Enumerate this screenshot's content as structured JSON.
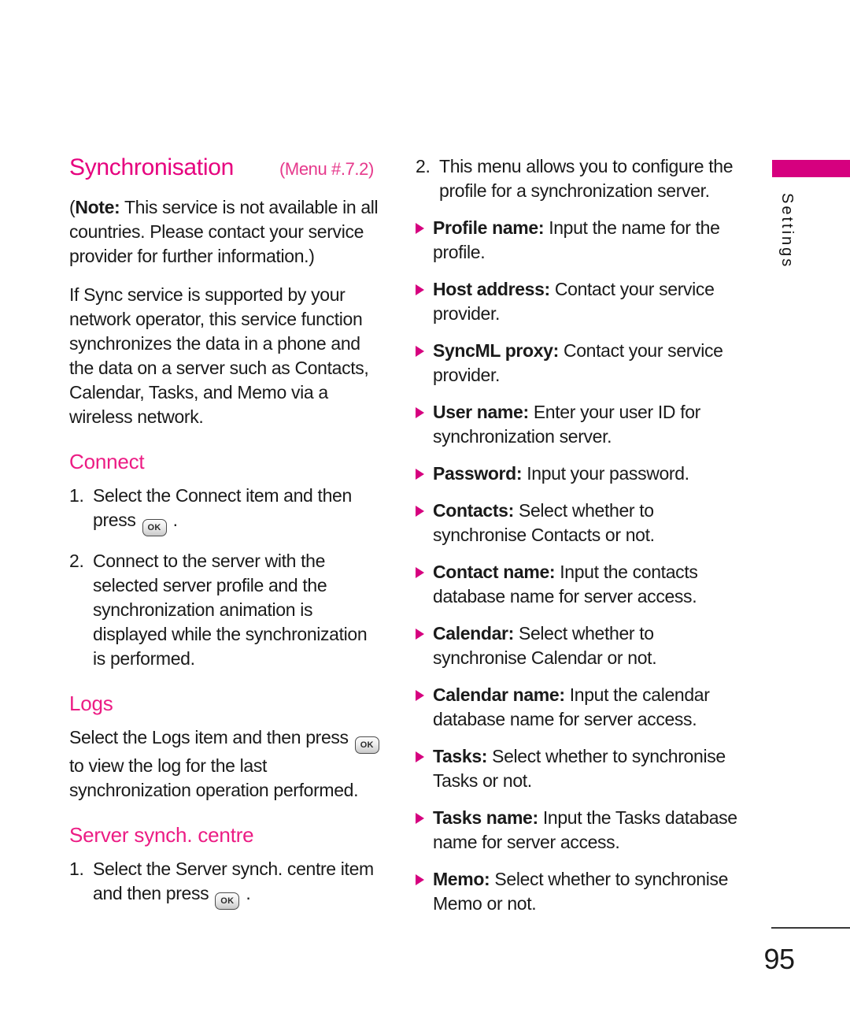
{
  "page": {
    "number": "95",
    "side_tab_label": "Settings",
    "accent_color": "#D6007F",
    "heading_color": "#E6007E",
    "subheading_color": "#EC1C84"
  },
  "left_column": {
    "chapter_title": "Synchronisation",
    "chapter_menu": "(Menu #.7.2)",
    "note_prefix": "(",
    "note_label": "Note:",
    "note_text": " This service is not available in all countries. Please contact your service provider for further information.)",
    "intro": "If Sync service is supported by your network operator, this service function synchronizes the data in a phone and the data on a server such as Contacts, Calendar, Tasks, and Memo via a wireless network.",
    "connect": {
      "heading": "Connect",
      "items": [
        {
          "marker": "1.",
          "text_before": "Select the Connect item and then press ",
          "key": "OK",
          "text_after": " ."
        },
        {
          "marker": "2.",
          "text_before": "Connect to the server with the selected server profile and the synchronization animation is displayed while the synchronization is performed.",
          "key": "",
          "text_after": ""
        }
      ]
    },
    "logs": {
      "heading": "Logs",
      "text_before": "Select the Logs item and then press ",
      "key": "OK",
      "text_after": " to view the log for the last synchronization operation performed."
    },
    "server_synch": {
      "heading": "Server synch. centre",
      "items": [
        {
          "marker": "1.",
          "text_before": "Select the Server synch. centre item and then press ",
          "key": "OK",
          "text_after": " ."
        }
      ]
    }
  },
  "right_column": {
    "numbered": [
      {
        "marker": "2.",
        "text": "This menu allows you to configure the profile for a synchronization server."
      }
    ],
    "bullets": [
      {
        "label": "Profile name:",
        "text": " Input the name for the profile."
      },
      {
        "label": "Host address:",
        "text": " Contact your service provider."
      },
      {
        "label": "SyncML proxy:",
        "text": " Contact your service provider."
      },
      {
        "label": "User name:",
        "text": " Enter your user ID for synchronization server."
      },
      {
        "label": "Password:",
        "text": " Input your password."
      },
      {
        "label": "Contacts:",
        "text": " Select whether to synchronise Contacts or not."
      },
      {
        "label": "Contact name:",
        "text": " Input the contacts database name for server access."
      },
      {
        "label": "Calendar:",
        "text": " Select whether to synchronise Calendar or not."
      },
      {
        "label": "Calendar name:",
        "text": " Input the calendar database name for server access."
      },
      {
        "label": "Tasks:",
        "text": " Select whether to synchronise Tasks or not."
      },
      {
        "label": "Tasks name:",
        "text": " Input the Tasks database name for server access."
      },
      {
        "label": "Memo:",
        "text": " Select whether to synchronise Memo or not."
      }
    ]
  }
}
